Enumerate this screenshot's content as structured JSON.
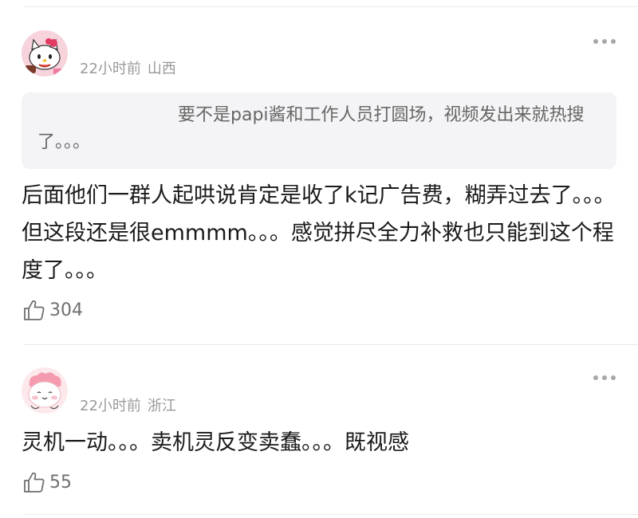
{
  "comments": [
    {
      "time": "22小时前",
      "location": "山西",
      "avatar_icon": "hello-kitty-avatar",
      "quote": "要不是papi酱和工作人员打圆场，视频发出来就热搜了。。。",
      "text": "后面他们一群人起哄说肯定是收了k记广告费，糊弄过去了。。。但这段还是很emmmm。。。感觉拼尽全力补救也只能到这个程度了。。。",
      "likes": "304"
    },
    {
      "time": "22小时前",
      "location": "浙江",
      "avatar_icon": "pink-blob-avatar",
      "text": "灵机一动。。。卖机灵反变卖蠢。。。既视感",
      "likes": "55"
    }
  ],
  "colors": {
    "meta": "#9a9a9a",
    "body": "#1a1a1a",
    "quote_bg": "#f4f4f6",
    "divider": "#e9e9e9"
  }
}
